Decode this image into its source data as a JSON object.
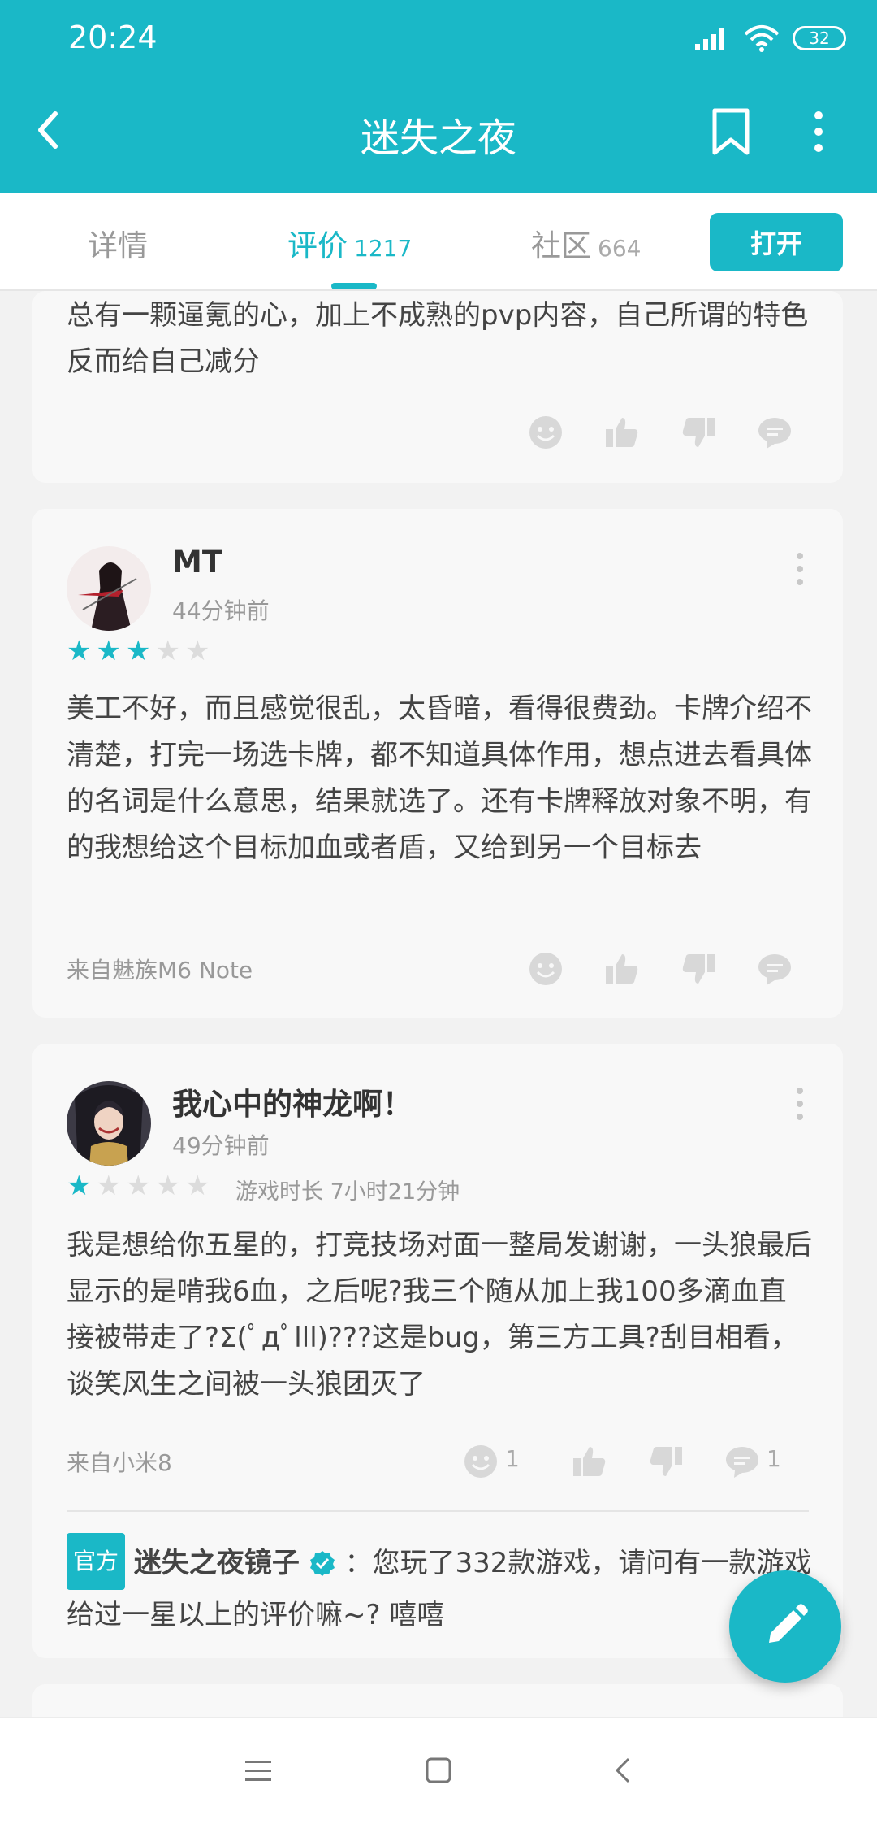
{
  "status_bar": {
    "time": "20:24",
    "battery": "32"
  },
  "header": {
    "title": "迷失之夜"
  },
  "tabs": [
    {
      "label": "详情",
      "count": ""
    },
    {
      "label": "评价",
      "count": "1217"
    },
    {
      "label": "社区",
      "count": "664"
    }
  ],
  "open_button": "打开",
  "review0": {
    "text": "总有一颗逼氪的心，加上不成熟的pvp内容，自己所谓的特色反而给自己减分"
  },
  "review1": {
    "user": "MT",
    "time": "44分钟前",
    "rating": 3,
    "text": "美工不好，而且感觉很乱，太昏暗，看得很费劲。卡牌介绍不清楚，打完一场选卡牌，都不知道具体作用，想点进去看具体的名词是什么意思，结果就选了。还有卡牌释放对象不明，有的我想给这个目标加血或者盾，又给到另一个目标去",
    "device": "来自魅族M6 Note"
  },
  "review2": {
    "user": "我心中的神龙啊！",
    "time": "49分钟前",
    "rating": 1,
    "playtime": "游戏时长 7小时21分钟",
    "text": "我是想给你五星的，打竞技场对面一整局发谢谢，一头狼最后显示的是啃我6血，之后呢?我三个随从加上我100多滴血直接被带走了?Σ(ﾟдﾟlll)???这是bug，第三方工具?刮目相看，谈笑风生之间被一头狼团灭了",
    "device": "来自小米8",
    "emoji_count": "1",
    "comment_count": "1",
    "reply": {
      "badge": "官方",
      "name": "迷失之夜镜子",
      "text": "：您玩了332款游戏，请问有一款游戏给过一星以上的评价嘛~? 嘻嘻"
    }
  },
  "colors": {
    "accent": "#1ab8c7",
    "card": "#f8f8f8"
  }
}
